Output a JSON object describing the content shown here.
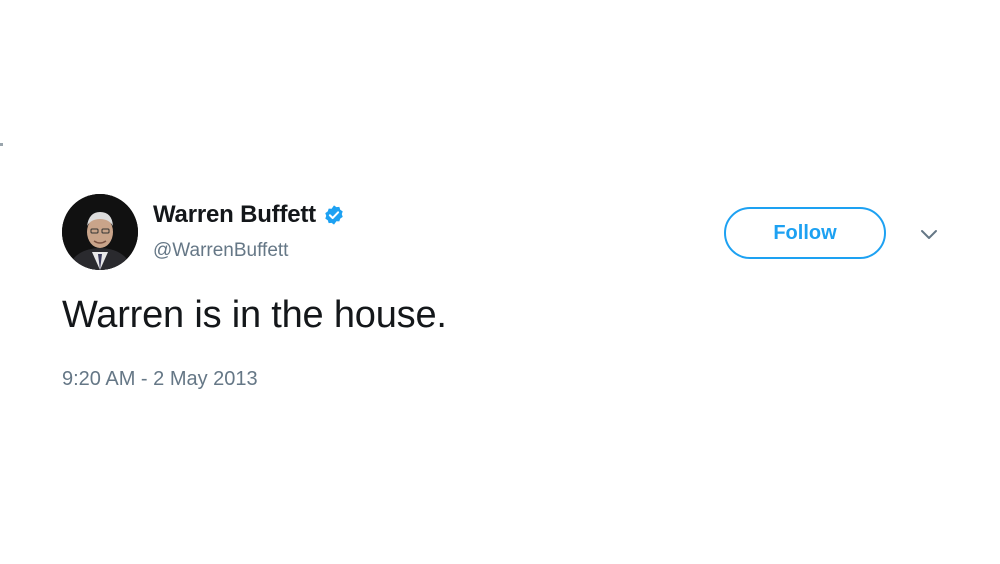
{
  "user": {
    "display_name": "Warren Buffett",
    "handle": "@WarrenBuffett",
    "verified": true,
    "avatar_icon": "profile-photo"
  },
  "actions": {
    "follow_label": "Follow",
    "more_icon": "chevron-down-icon"
  },
  "tweet": {
    "text": "Warren is in the house.",
    "timestamp": "9:20 AM - 2 May 2013"
  },
  "colors": {
    "accent": "#1da1f2",
    "text_primary": "#14171a",
    "text_secondary": "#657786",
    "background": "#ffffff"
  }
}
